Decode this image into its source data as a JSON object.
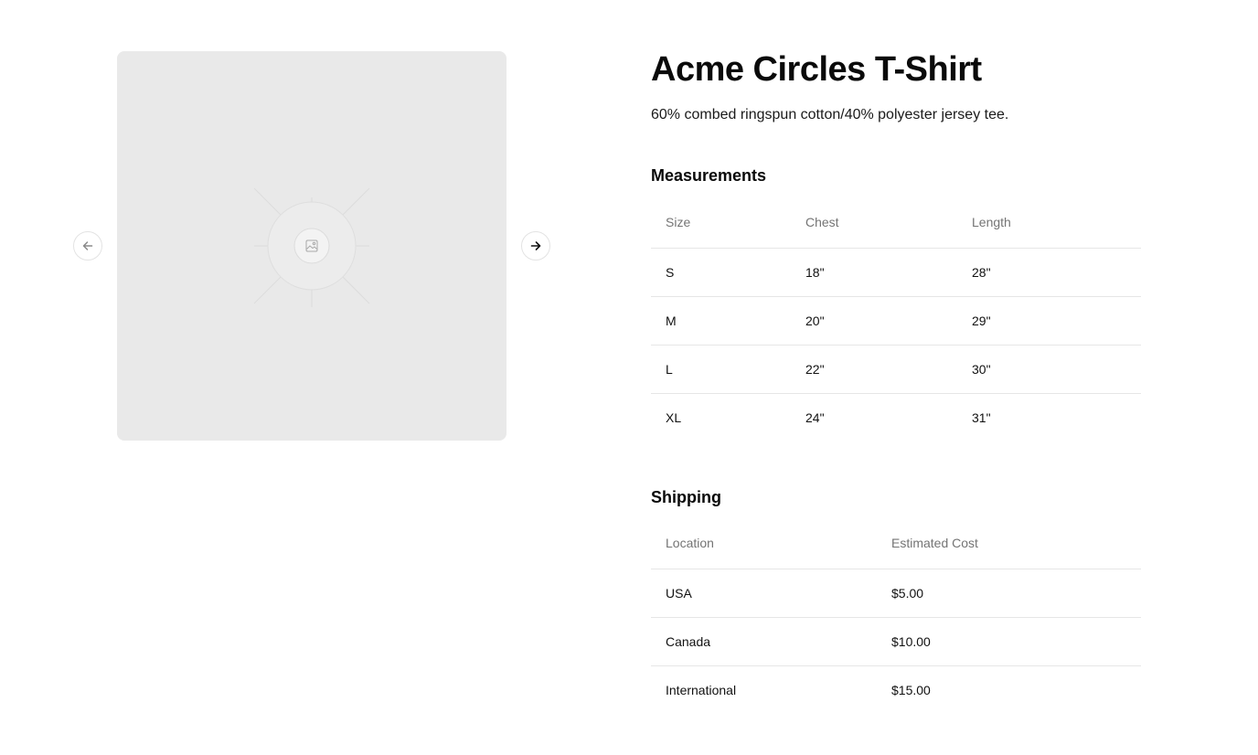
{
  "product": {
    "title": "Acme Circles T-Shirt",
    "description": "60% combed ringspun cotton/40% polyester jersey tee."
  },
  "gallery": {
    "image_icon": "image-placeholder-icon",
    "prev_icon": "arrow-left-icon",
    "next_icon": "arrow-right-icon"
  },
  "measurements": {
    "title": "Measurements",
    "headers": [
      "Size",
      "Chest",
      "Length"
    ],
    "rows": [
      [
        "S",
        "18\"",
        "28\""
      ],
      [
        "M",
        "20\"",
        "29\""
      ],
      [
        "L",
        "22\"",
        "30\""
      ],
      [
        "XL",
        "24\"",
        "31\""
      ]
    ]
  },
  "shipping": {
    "title": "Shipping",
    "headers": [
      "Location",
      "Estimated Cost"
    ],
    "rows": [
      [
        "USA",
        "$5.00"
      ],
      [
        "Canada",
        "$10.00"
      ],
      [
        "International",
        "$15.00"
      ]
    ]
  }
}
